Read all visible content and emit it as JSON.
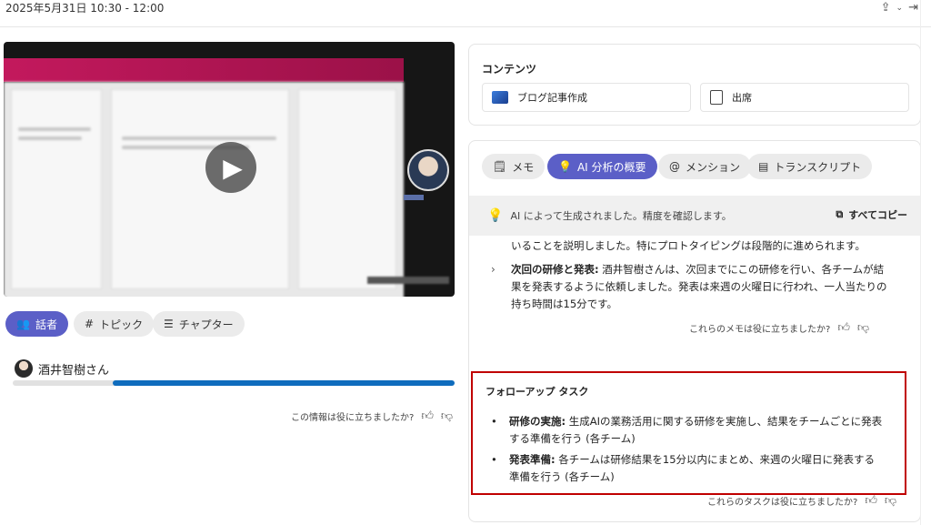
{
  "header": {
    "meeting_time": "2025年5月31日 10:30 - 12:00"
  },
  "left": {
    "tabs": [
      {
        "label": "話者",
        "icon": "people-icon",
        "active": true
      },
      {
        "label": "トピック",
        "icon": "hash-icon",
        "active": false
      },
      {
        "label": "チャプター",
        "icon": "list-icon",
        "active": false
      }
    ],
    "speaker_name": "酒井智樹さん",
    "feedback_question": "この情報は役に立ちましたか?"
  },
  "content_card": {
    "title": "コンテンツ",
    "items": [
      {
        "label": "ブログ記事作成",
        "icon": "blog-icon"
      },
      {
        "label": "出席",
        "icon": "attendance-icon"
      }
    ]
  },
  "analysis": {
    "tabs": [
      {
        "label": "メモ",
        "icon": "note-icon",
        "active": false
      },
      {
        "label": "AI 分析の概要",
        "icon": "bulb-icon",
        "active": true
      },
      {
        "label": "メンション",
        "icon": "at-icon",
        "active": false
      },
      {
        "label": "トランスクリプト",
        "icon": "transcript-icon",
        "active": false
      }
    ],
    "banner_text": "AI によって生成されました。精度を確認します。",
    "copy_all_label": "すべてコピー",
    "partial_line": "いることを説明しました。特にプロトタイピングは段階的に進められます。",
    "next_item_title": "次回の研修と発表:",
    "next_item_body_1": " 酒井智樹さんは、次回までにこの研修を行い、各チームが結",
    "next_item_body_2": "果を発表するように依頼しました。発表は来週の火曜日に行われ、一人当たりの",
    "next_item_body_3": "持ち時間は15分です。",
    "notes_feedback": "これらのメモは役に立ちましたか?",
    "followup_title": "フォローアップ タスク",
    "tasks": [
      {
        "title": "研修の実施:",
        "line1": " 生成AIの業務活用に関する研修を実施し、結果をチームごとに発表",
        "line2": "する準備を行う (各チーム)"
      },
      {
        "title": "発表準備:",
        "line1": " 各チームは研修結果を15分以内にまとめ、来週の火曜日に発表する",
        "line2": "準備を行う (各チーム)"
      }
    ],
    "tasks_feedback": "これらのタスクは役に立ちましたか?"
  }
}
